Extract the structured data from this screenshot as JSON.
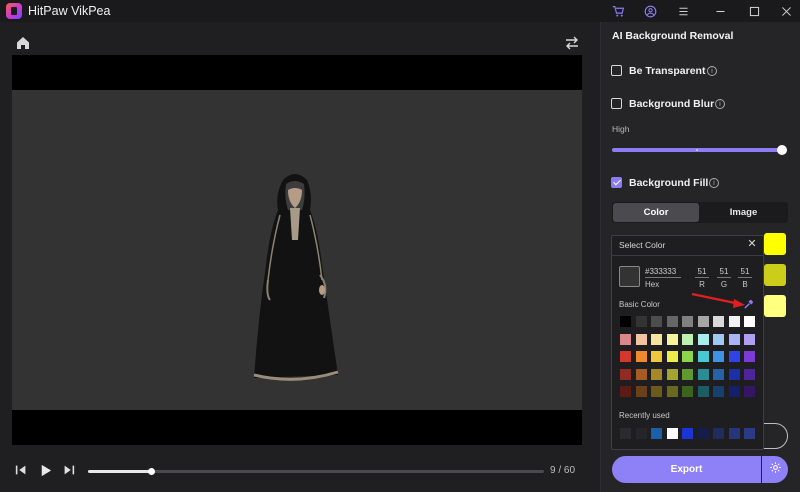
{
  "app": {
    "title": "HitPaw VikPea"
  },
  "title_icons": [
    "cart-icon",
    "account-icon",
    "menu-icon",
    "minimize-icon",
    "maximize-icon",
    "close-icon"
  ],
  "player": {
    "frame_readout": "9 / 60",
    "progress_fraction": 0.14,
    "background_color": "#333333"
  },
  "panel": {
    "title": "AI Background Removal",
    "options": [
      {
        "label": "Be Transparent",
        "checked": false
      },
      {
        "label": "Background Blur",
        "checked": false
      },
      {
        "label": "Background Fill",
        "checked": true
      }
    ],
    "blur_level_label": "High",
    "blur_level_fraction": 1.0,
    "tabs": [
      {
        "label": "Color",
        "active": true
      },
      {
        "label": "Image",
        "active": false
      }
    ],
    "preset_swatches": [
      "#ffff00",
      "#cccc1a",
      "#ffff80"
    ],
    "export_label": "Export"
  },
  "color_popup": {
    "title": "Select Color",
    "hex_value": "#333333",
    "hex_label": "Hex",
    "r": "51",
    "g": "51",
    "b": "51",
    "r_label": "R",
    "g_label": "G",
    "b_label": "B",
    "basic_color_label": "Basic Color",
    "basic_colors": [
      [
        "#000000",
        "#333333",
        "#4d4d4d",
        "#666666",
        "#808080",
        "#a6a6a6",
        "#d9d9d9",
        "#f2f2f2",
        "#ffffff"
      ],
      [
        "#d9878b",
        "#f2c39e",
        "#f6e3a0",
        "#f6f49c",
        "#bdf0b0",
        "#a8ecef",
        "#9dc8f0",
        "#a9b4f6",
        "#b09ef2"
      ],
      [
        "#d4372b",
        "#ee8b2c",
        "#f0c73a",
        "#eeee49",
        "#8fd54b",
        "#48c8d0",
        "#3f93e4",
        "#2e44e6",
        "#7c3bd9"
      ],
      [
        "#922a21",
        "#a55b22",
        "#a6882a",
        "#a4a531",
        "#5f9a31",
        "#2a8d95",
        "#2862a6",
        "#1d2fa4",
        "#4f239a"
      ],
      [
        "#5e1a14",
        "#6b3f1a",
        "#6c5a1c",
        "#6a6a1f",
        "#3d641f",
        "#1b5d62",
        "#174070",
        "#14206c",
        "#341665"
      ]
    ],
    "recent_label": "Recently used",
    "recent_colors": [
      "#2b2b2e",
      "#26262a",
      "#1a5fa8",
      "#ffffff",
      "#1b34d6",
      "#151e4a",
      "#1e2d5e",
      "#27367a",
      "#2a3a86"
    ]
  },
  "icons": {
    "home": "home-icon",
    "swap": "swap-icon",
    "prev_frame": "prev-frame-icon",
    "play": "play-icon",
    "next_frame": "next-frame-icon",
    "info": "info-icon",
    "eyedropper": "eyedropper-icon",
    "settings": "gear-icon"
  },
  "colors": {
    "accent": "#8e80f6",
    "annotation_arrow": "#e02020"
  }
}
